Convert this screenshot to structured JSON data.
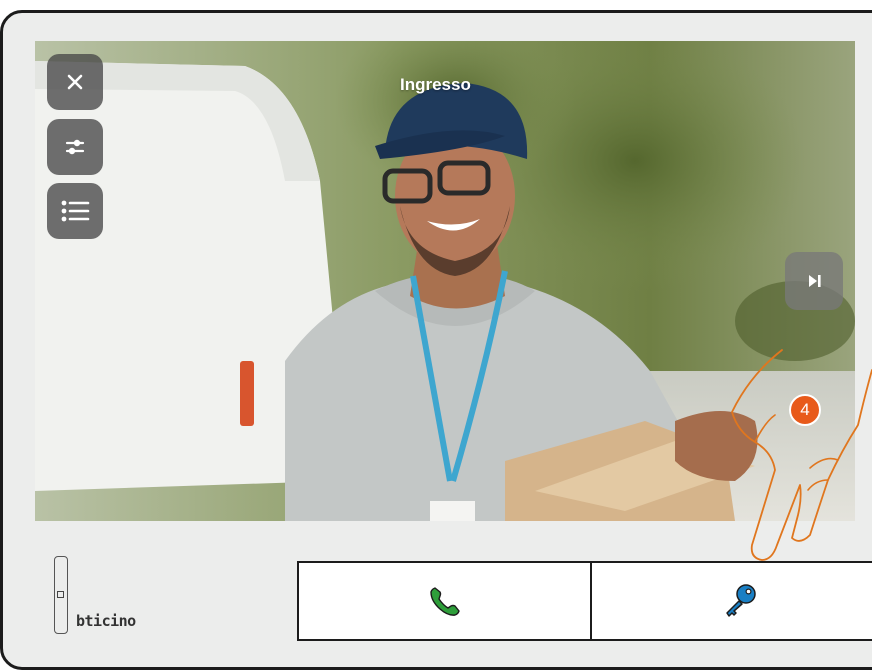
{
  "camera": {
    "title": "Ingresso"
  },
  "controls": {
    "close": {
      "icon": "close-icon"
    },
    "settings": {
      "icon": "sliders-icon"
    },
    "menu": {
      "icon": "list-icon"
    },
    "next": {
      "icon": "skip-next-icon"
    }
  },
  "annotation": {
    "step": "4"
  },
  "brand": {
    "name": "bticino"
  },
  "bottom_buttons": [
    {
      "icon": "phone-icon",
      "color": "#2e9e3a"
    },
    {
      "icon": "key-icon",
      "color": "#1a7fc4"
    }
  ],
  "colors": {
    "overlay_button": "#484848",
    "badge": "#e85a1a",
    "frame": "#1c1c1c"
  }
}
